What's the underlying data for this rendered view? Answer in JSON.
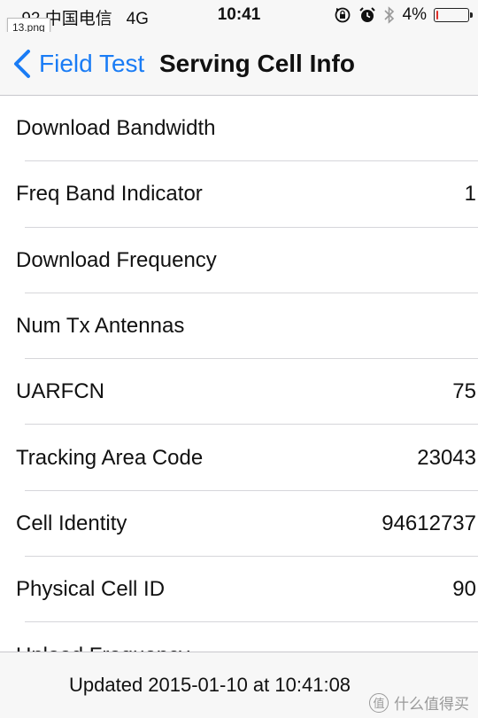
{
  "status_bar": {
    "carrier": "-92 中国电信",
    "network": "4G",
    "time": "10:41",
    "battery_percent": "4%",
    "battery_level": 0.04,
    "battery_fill_color": "#e0302a",
    "icons": [
      "rotation-lock-icon",
      "alarm-icon",
      "bluetooth-icon",
      "battery-icon"
    ]
  },
  "overlay": {
    "file_tag": "13.png"
  },
  "nav": {
    "back_label": "Field Test",
    "title": "Serving Cell Info",
    "accent_color": "#1a7cf5"
  },
  "rows": [
    {
      "label": "Download Bandwidth",
      "value": ""
    },
    {
      "label": "Freq Band Indicator",
      "value": "1"
    },
    {
      "label": "Download Frequency",
      "value": ""
    },
    {
      "label": "Num Tx Antennas",
      "value": ""
    },
    {
      "label": "UARFCN",
      "value": "75"
    },
    {
      "label": "Tracking Area Code",
      "value": "23043"
    },
    {
      "label": "Cell Identity",
      "value": "94612737"
    },
    {
      "label": "Physical Cell ID",
      "value": "90"
    },
    {
      "label": "Upload Frequency",
      "value": ""
    }
  ],
  "toolbar": {
    "updated_text": "Updated 2015-01-10 at 10:41:08"
  },
  "watermark": {
    "badge": "值",
    "text": "什么值得买"
  }
}
